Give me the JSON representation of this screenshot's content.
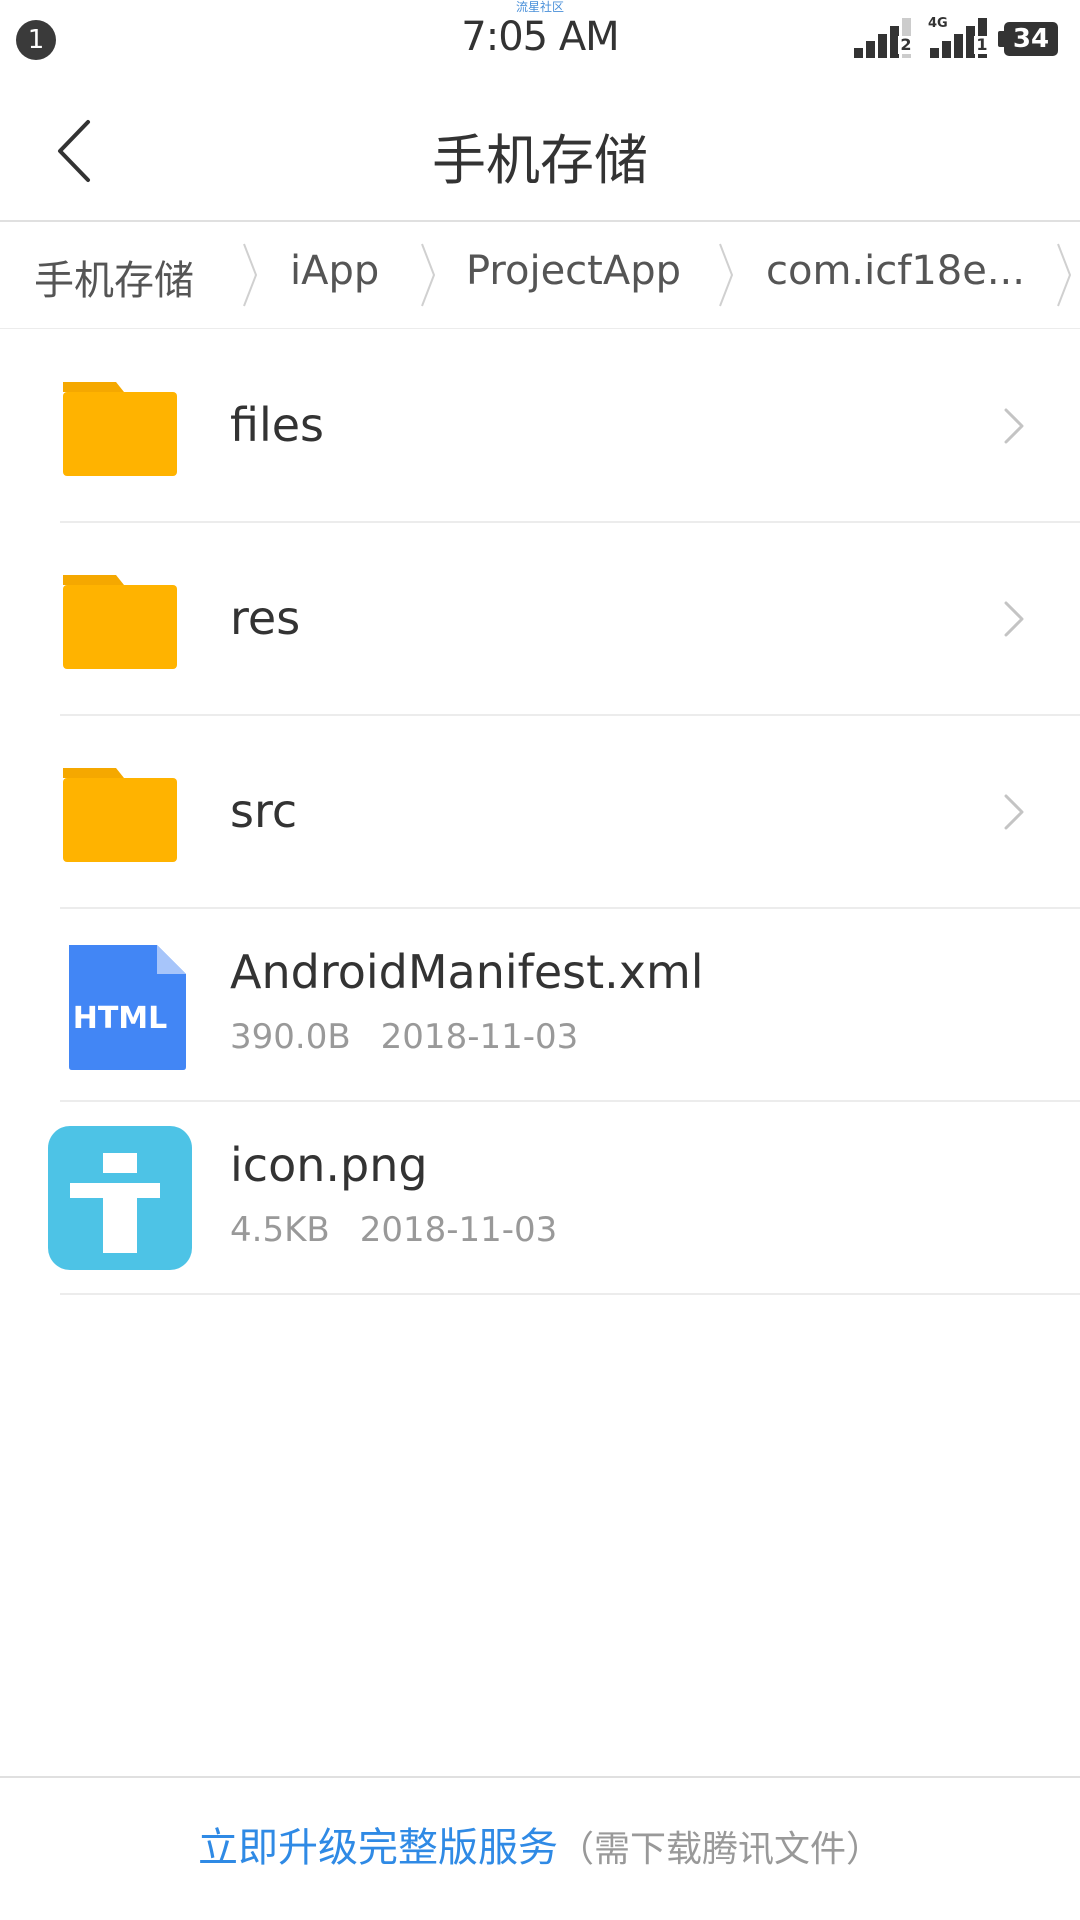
{
  "status_bar": {
    "notification_count": "1",
    "watermark": "流星社区",
    "time": "7:05 AM",
    "sim1_label": "2",
    "sim2_label": "1",
    "network_type": "4G",
    "battery_level": "34"
  },
  "header": {
    "title": "手机存储",
    "back_icon": "chevron-left-icon"
  },
  "breadcrumb": [
    {
      "label": "手机存储"
    },
    {
      "label": "iApp"
    },
    {
      "label": "ProjectApp"
    },
    {
      "label": "com.icf18e..."
    }
  ],
  "files": [
    {
      "name": "files",
      "type": "folder"
    },
    {
      "name": "res",
      "type": "folder"
    },
    {
      "name": "src",
      "type": "folder"
    },
    {
      "name": "AndroidManifest.xml",
      "type": "html-file",
      "icon_text": "HTML",
      "size": "390.0B",
      "date": "2018-11-03"
    },
    {
      "name": "icon.png",
      "type": "image-file",
      "size": "4.5KB",
      "date": "2018-11-03"
    }
  ],
  "bottom_bar": {
    "upgrade_label": "立即升级完整版服务",
    "upgrade_note": "（需下载腾讯文件）"
  },
  "colors": {
    "folder": "#ffb300",
    "folder_tab": "#f5a800",
    "html_icon": "#4286f5",
    "image_icon": "#4dc3e6",
    "link_blue": "#2f8ae5"
  }
}
